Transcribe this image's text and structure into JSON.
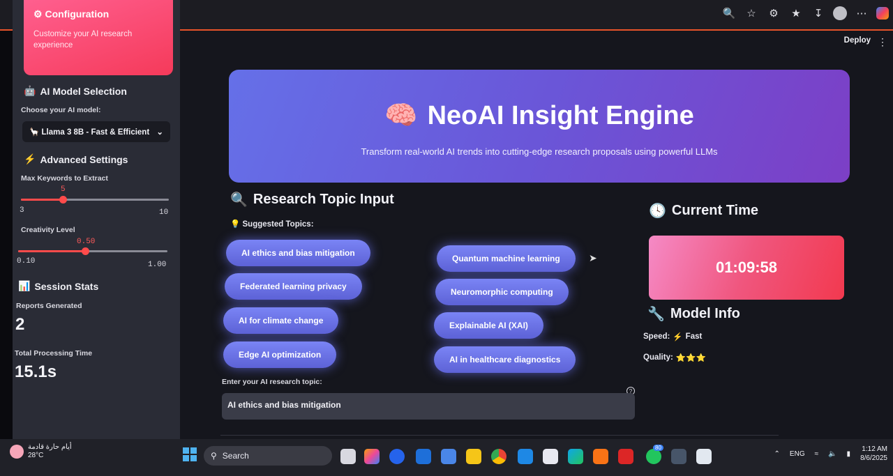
{
  "browser": {
    "icons": [
      "zoom-icon",
      "star-icon",
      "extensions-icon",
      "favorites-icon",
      "download-icon",
      "profile-icon",
      "more-icon",
      "copilot-icon"
    ]
  },
  "sidebar": {
    "config_title": "Configuration",
    "config_subtitle": "Customize your AI research experience",
    "model_section": "AI Model Selection",
    "model_label": "Choose your AI model:",
    "model_selected": "Llama 3 8B - Fast & Efficient",
    "advanced_section": "Advanced Settings",
    "keywords_label": "Max Keywords to Extract",
    "keywords_value": "5",
    "keywords_min": "3",
    "keywords_max": "10",
    "creativity_label": "Creativity Level",
    "creativity_value": "0.50",
    "creativity_min": "0.10",
    "creativity_max": "1.00",
    "stats_section": "Session Stats",
    "reports_label": "Reports Generated",
    "reports_value": "2",
    "processing_label": "Total Processing Time",
    "processing_value": "15.1s"
  },
  "header": {
    "deploy": "Deploy",
    "menu": "⋮"
  },
  "hero": {
    "title": "NeoAI Insight Engine",
    "subtitle": "Transform real-world AI trends into cutting-edge research proposals using powerful LLMs"
  },
  "research": {
    "heading": "Research Topic Input",
    "suggested_label": "Suggested Topics:",
    "topics_left": [
      "AI ethics and bias mitigation",
      "Federated learning privacy",
      "AI for climate change",
      "Edge AI optimization"
    ],
    "topics_right": [
      "Quantum machine learning",
      "Neuromorphic computing",
      "Explainable AI (XAI)",
      "AI in healthcare diagnostics"
    ],
    "input_label": "Enter your AI research topic:",
    "input_value": "AI ethics and bias mitigation"
  },
  "time": {
    "heading": "Current Time",
    "value": "01:09:58"
  },
  "model_info": {
    "heading": "Model Info",
    "speed_label": "Speed:",
    "speed_value": "Fast",
    "quality_label": "Quality:",
    "quality_stars": "⭐⭐⭐"
  },
  "taskbar": {
    "weather_text": "أيام حارة قادمة",
    "temperature": "28°C",
    "search_placeholder": "Search",
    "language": "ENG",
    "time": "1:12 AM",
    "date": "8/6/2025",
    "badge": "80"
  },
  "colors": {
    "accent_red": "#ff4b4b",
    "hero_start": "#6570e8",
    "hero_end": "#7c3fc6",
    "pill": "#6a70e6"
  }
}
